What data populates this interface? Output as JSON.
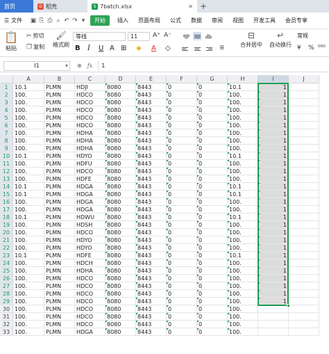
{
  "tabs": {
    "home": "首页",
    "doc": "稻壳",
    "file": "7batch.xlsx",
    "add": "+"
  },
  "menu": {
    "file": "文件",
    "items": [
      "开始",
      "插入",
      "页面布局",
      "公式",
      "数据",
      "审阅",
      "视图",
      "开发工具",
      "会员专享"
    ],
    "active_index": 0
  },
  "ribbon": {
    "paste": "粘贴",
    "cut": "剪切",
    "copy": "复制",
    "format_painter": "格式刷",
    "font_name": "等线",
    "font_size": "11",
    "merge_center": "合并居中",
    "wrap_text": "自动换行",
    "number_format": "常规"
  },
  "formula_bar": {
    "name_box": "I1",
    "formula": "1"
  },
  "colors": {
    "accent_green": "#1f9d55",
    "tab_blue": "#3c78d8"
  },
  "sheet": {
    "columns": [
      "A",
      "B",
      "C",
      "D",
      "E",
      "F",
      "G",
      "H",
      "I",
      "J"
    ],
    "selected_column": "I",
    "rows": [
      {
        "n": "1",
        "a": "10.1",
        "b": "PLMN",
        "c": "HDJI",
        "d": "8080",
        "e": "8443",
        "f": "0",
        "g": "0",
        "h": "10.1",
        "i": "1"
      },
      {
        "n": "2",
        "a": "100.",
        "b": "PLMN",
        "c": "HDCO",
        "d": "8080",
        "e": "8443",
        "f": "0",
        "g": "0",
        "h": "100.",
        "i": "1"
      },
      {
        "n": "3",
        "a": "100.",
        "b": "PLMN",
        "c": "HDCO",
        "d": "8080",
        "e": "8443",
        "f": "0",
        "g": "0",
        "h": "100.",
        "i": "1"
      },
      {
        "n": "4",
        "a": "100.",
        "b": "PLMN",
        "c": "HDCO",
        "d": "8080",
        "e": "8443",
        "f": "0",
        "g": "0",
        "h": "100.",
        "i": "1"
      },
      {
        "n": "5",
        "a": "100.",
        "b": "PLMN",
        "c": "HDCO",
        "d": "8080",
        "e": "8443",
        "f": "0",
        "g": "0",
        "h": "100.",
        "i": "1"
      },
      {
        "n": "6",
        "a": "100.",
        "b": "PLMN",
        "c": "HDCO",
        "d": "8080",
        "e": "8443",
        "f": "0",
        "g": "0",
        "h": "100.",
        "i": "1"
      },
      {
        "n": "7",
        "a": "100.",
        "b": "PLMN",
        "c": "HDHA",
        "d": "8080",
        "e": "8443",
        "f": "0",
        "g": "0",
        "h": "100.",
        "i": "1"
      },
      {
        "n": "8",
        "a": "100.",
        "b": "PLMN",
        "c": "HDHA",
        "d": "8080",
        "e": "8443",
        "f": "0",
        "g": "0",
        "h": "100.",
        "i": "1"
      },
      {
        "n": "9",
        "a": "100.",
        "b": "PLMN",
        "c": "HDHA",
        "d": "8080",
        "e": "8443",
        "f": "0",
        "g": "0",
        "h": "100.",
        "i": "1"
      },
      {
        "n": "10",
        "a": "10.1",
        "b": "PLMN",
        "c": "HDYO",
        "d": "8080",
        "e": "8443",
        "f": "0",
        "g": "0",
        "h": "10.1",
        "i": "1"
      },
      {
        "n": "11",
        "a": "100.",
        "b": "PLMN",
        "c": "HDFU",
        "d": "8080",
        "e": "8443",
        "f": "0",
        "g": "0",
        "h": "100.",
        "i": "1"
      },
      {
        "n": "12",
        "a": "100.",
        "b": "PLMN",
        "c": "HDCO",
        "d": "8080",
        "e": "8443",
        "f": "0",
        "g": "0",
        "h": "100.",
        "i": "1"
      },
      {
        "n": "13",
        "a": "100.",
        "b": "PLMN",
        "c": "HDFE",
        "d": "8080",
        "e": "8443",
        "f": "0",
        "g": "0",
        "h": "100.",
        "i": "1"
      },
      {
        "n": "14",
        "a": "10.1",
        "b": "PLMN",
        "c": "HDGA",
        "d": "8080",
        "e": "8443",
        "f": "0",
        "g": "0",
        "h": "10.1",
        "i": "1"
      },
      {
        "n": "15",
        "a": "10.1",
        "b": "PLMN",
        "c": "HDGA",
        "d": "8080",
        "e": "8443",
        "f": "0",
        "g": "0",
        "h": "10.1",
        "i": "1"
      },
      {
        "n": "16",
        "a": "100.",
        "b": "PLMN",
        "c": "HDGA",
        "d": "8080",
        "e": "8443",
        "f": "0",
        "g": "0",
        "h": "100.",
        "i": "1"
      },
      {
        "n": "17",
        "a": "100.",
        "b": "PLMN",
        "c": "HDGA",
        "d": "8080",
        "e": "8443",
        "f": "0",
        "g": "0",
        "h": "100.",
        "i": "1"
      },
      {
        "n": "18",
        "a": "10.1",
        "b": "PLMN",
        "c": "HDWU",
        "d": "8080",
        "e": "8443",
        "f": "0",
        "g": "0",
        "h": "10.1",
        "i": "1"
      },
      {
        "n": "19",
        "a": "100.",
        "b": "PLMN",
        "c": "HDSH",
        "d": "8080",
        "e": "8443",
        "f": "0",
        "g": "0",
        "h": "100.",
        "i": "1"
      },
      {
        "n": "20",
        "a": "100.",
        "b": "PLMN",
        "c": "HDCO",
        "d": "8080",
        "e": "8443",
        "f": "0",
        "g": "0",
        "h": "100.",
        "i": "1"
      },
      {
        "n": "21",
        "a": "100.",
        "b": "PLMN",
        "c": "HDYO",
        "d": "8080",
        "e": "8443",
        "f": "0",
        "g": "0",
        "h": "100.",
        "i": "1"
      },
      {
        "n": "22",
        "a": "100.",
        "b": "PLMN",
        "c": "HDYO",
        "d": "8080",
        "e": "8443",
        "f": "0",
        "g": "0",
        "h": "100.",
        "i": "1"
      },
      {
        "n": "23",
        "a": "10.1",
        "b": "PLMN",
        "c": "HDFE",
        "d": "8080",
        "e": "8443",
        "f": "0",
        "g": "0",
        "h": "10.1",
        "i": "1"
      },
      {
        "n": "24",
        "a": "100.",
        "b": "PLMN",
        "c": "HDCH",
        "d": "8080",
        "e": "8443",
        "f": "0",
        "g": "0",
        "h": "100.",
        "i": "1"
      },
      {
        "n": "25",
        "a": "100.",
        "b": "PLMN",
        "c": "HDHA",
        "d": "8080",
        "e": "8443",
        "f": "0",
        "g": "0",
        "h": "100.",
        "i": "1"
      },
      {
        "n": "26",
        "a": "100.",
        "b": "PLMN",
        "c": "HDCO",
        "d": "8080",
        "e": "8443",
        "f": "0",
        "g": "0",
        "h": "100.",
        "i": "1"
      },
      {
        "n": "27",
        "a": "100.",
        "b": "PLMN",
        "c": "HDCO",
        "d": "8080",
        "e": "8443",
        "f": "0",
        "g": "0",
        "h": "100.",
        "i": "1"
      },
      {
        "n": "28",
        "a": "100.",
        "b": "PLMN",
        "c": "HDCO",
        "d": "8080",
        "e": "8443",
        "f": "0",
        "g": "0",
        "h": "100.",
        "i": "1"
      },
      {
        "n": "29",
        "a": "100.",
        "b": "PLMN",
        "c": "HDCO",
        "d": "8080",
        "e": "8443",
        "f": "0",
        "g": "0",
        "h": "100.",
        "i": "1"
      },
      {
        "n": "30",
        "a": "100.",
        "b": "PLMN",
        "c": "HDCO",
        "d": "8080",
        "e": "8443",
        "f": "0",
        "g": "0",
        "h": "100.",
        "i": ""
      },
      {
        "n": "31",
        "a": "100.",
        "b": "PLMN",
        "c": "HDCO",
        "d": "8080",
        "e": "8443",
        "f": "0",
        "g": "0",
        "h": "100.",
        "i": ""
      },
      {
        "n": "32",
        "a": "100.",
        "b": "PLMN",
        "c": "HDCO",
        "d": "8080",
        "e": "8443",
        "f": "0",
        "g": "0",
        "h": "100.",
        "i": ""
      },
      {
        "n": "33",
        "a": "100.",
        "b": "PLMN",
        "c": "HDGA",
        "d": "8080",
        "e": "8443",
        "f": "0",
        "g": "0",
        "h": "100.",
        "i": ""
      }
    ]
  }
}
